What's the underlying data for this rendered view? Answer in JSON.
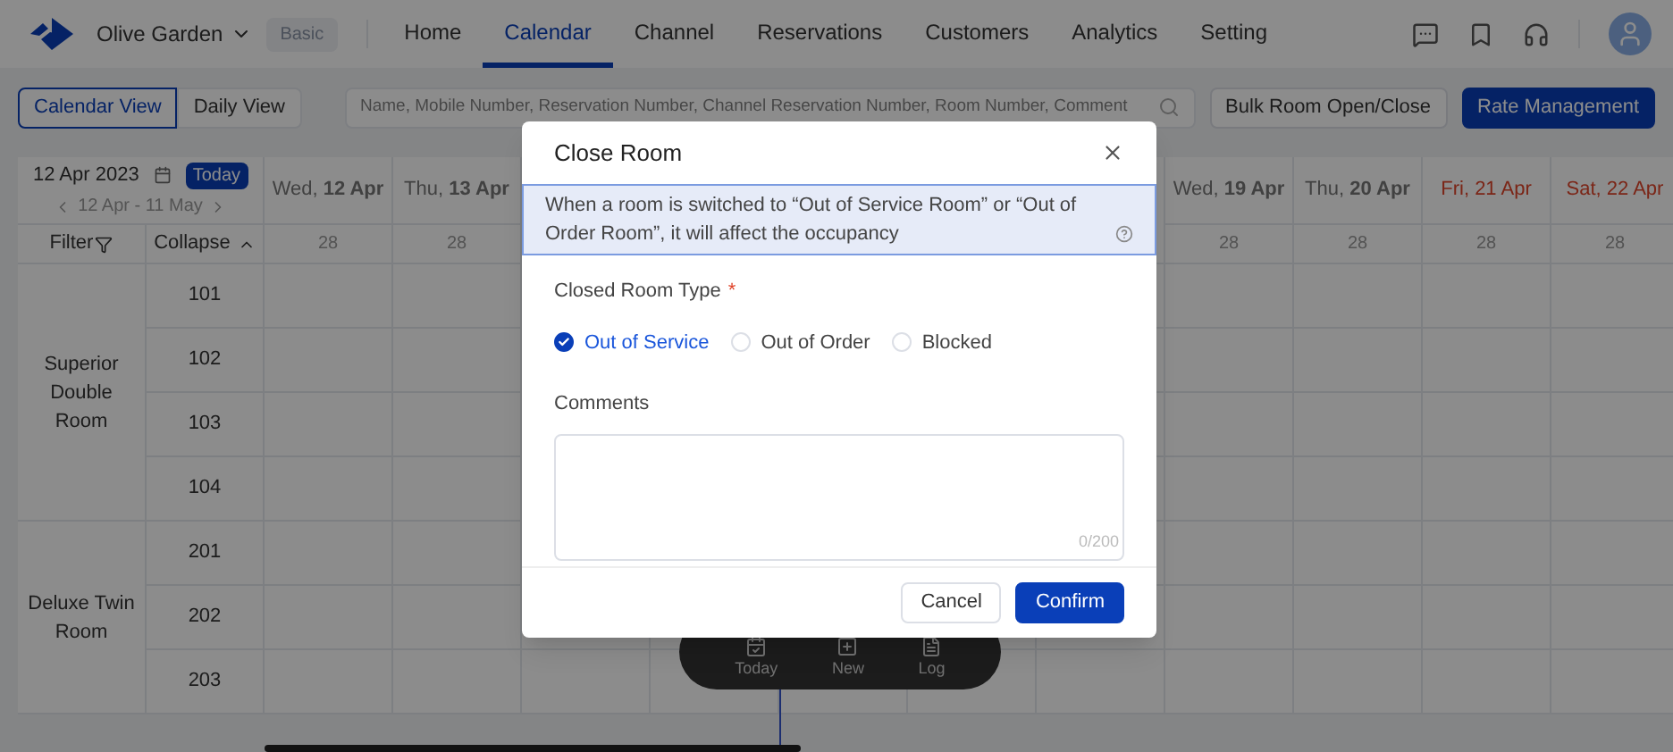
{
  "header": {
    "property": "Olive Garden",
    "plan": "Basic",
    "nav": [
      {
        "label": "Home",
        "selected": false
      },
      {
        "label": "Calendar",
        "selected": true
      },
      {
        "label": "Channel",
        "selected": false
      },
      {
        "label": "Reservations",
        "selected": false
      },
      {
        "label": "Customers",
        "selected": false
      },
      {
        "label": "Analytics",
        "selected": false
      },
      {
        "label": "Setting",
        "selected": false
      }
    ]
  },
  "toolbar": {
    "views": [
      {
        "label": "Calendar View",
        "selected": true
      },
      {
        "label": "Daily View",
        "selected": false
      }
    ],
    "search": {
      "placeholder": "Name, Mobile Number, Reservation Number, Channel Reservation Number, Room Number, Comment"
    },
    "buttons": [
      {
        "label": "Bulk Room Open/Close",
        "kind": "default"
      },
      {
        "label": "Rate Management",
        "kind": "primary"
      }
    ]
  },
  "calendar": {
    "date": "12 Apr 2023",
    "today": "Today",
    "range": "12 Apr - 11 May",
    "filter": "Filter",
    "collapse": "Collapse",
    "days_left": [
      {
        "label": "Wed, **12 Apr**",
        "count": "28",
        "weekend": false
      },
      {
        "label": "Thu, **13 Apr**",
        "count": "28",
        "weekend": false
      }
    ],
    "days_right": [
      {
        "label": "Wed, **19 Apr**",
        "count": "28",
        "weekend": false
      },
      {
        "label": "Thu, **20 Apr**",
        "count": "28",
        "weekend": false
      },
      {
        "label": "Fri, 21 Apr",
        "count": "28",
        "weekend": true
      },
      {
        "label": "Sat, 22 Apr",
        "count": "28",
        "weekend": true
      }
    ],
    "room_types": [
      {
        "name": "Superior Double Room",
        "rooms": [
          "101",
          "102",
          "103",
          "104"
        ]
      },
      {
        "name": "Deluxe Twin Room",
        "rooms": [
          "201",
          "202",
          "203"
        ]
      }
    ]
  },
  "dock": [
    {
      "label": "Today",
      "kind": "today"
    },
    {
      "label": "New",
      "kind": "new"
    },
    {
      "label": "Log",
      "kind": "log"
    }
  ],
  "dialog": {
    "title": "Close Room",
    "notice": "When a room is switched to “Out of Service Room” or “Out of Order Room”, it will affect the occupancy",
    "type_label": "Closed Room Type",
    "required": "*",
    "options": [
      {
        "label": "Out of Service",
        "selected": true
      },
      {
        "label": "Out of Order",
        "selected": false
      },
      {
        "label": "Blocked",
        "selected": false
      }
    ],
    "comments_label": "Comments",
    "counter": "0/200",
    "buttons": [
      {
        "label": "Cancel",
        "kind": "default"
      },
      {
        "label": "Confirm",
        "kind": "primary"
      }
    ]
  }
}
